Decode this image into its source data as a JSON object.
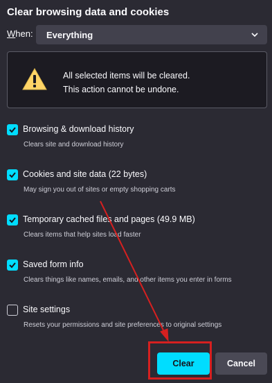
{
  "dialog": {
    "title": "Clear browsing data and cookies",
    "when_label_prefix": "W",
    "when_label_rest": "hen:",
    "time_range": "Everything",
    "warning": {
      "line1": "All selected items will be cleared.",
      "line2": "This action cannot be undone."
    },
    "items": [
      {
        "label": "Browsing & download history",
        "description": "Clears site and download history",
        "checked": true
      },
      {
        "label": "Cookies and site data (22 bytes)",
        "description": "May sign you out of sites or empty shopping carts",
        "checked": true
      },
      {
        "label": "Temporary cached files and pages (49.9 MB)",
        "description": "Clears items that help sites load faster",
        "checked": true
      },
      {
        "label": "Saved form info",
        "description": "Clears things like names, emails, and other items you enter in forms",
        "checked": true
      },
      {
        "label": "Site settings",
        "description": "Resets your permissions and site preferences to original settings",
        "checked": false
      }
    ],
    "buttons": {
      "clear": "Clear",
      "cancel": "Cancel"
    }
  },
  "colors": {
    "background": "#2b2a33",
    "accent": "#00ddff",
    "annotation": "#d62020"
  }
}
